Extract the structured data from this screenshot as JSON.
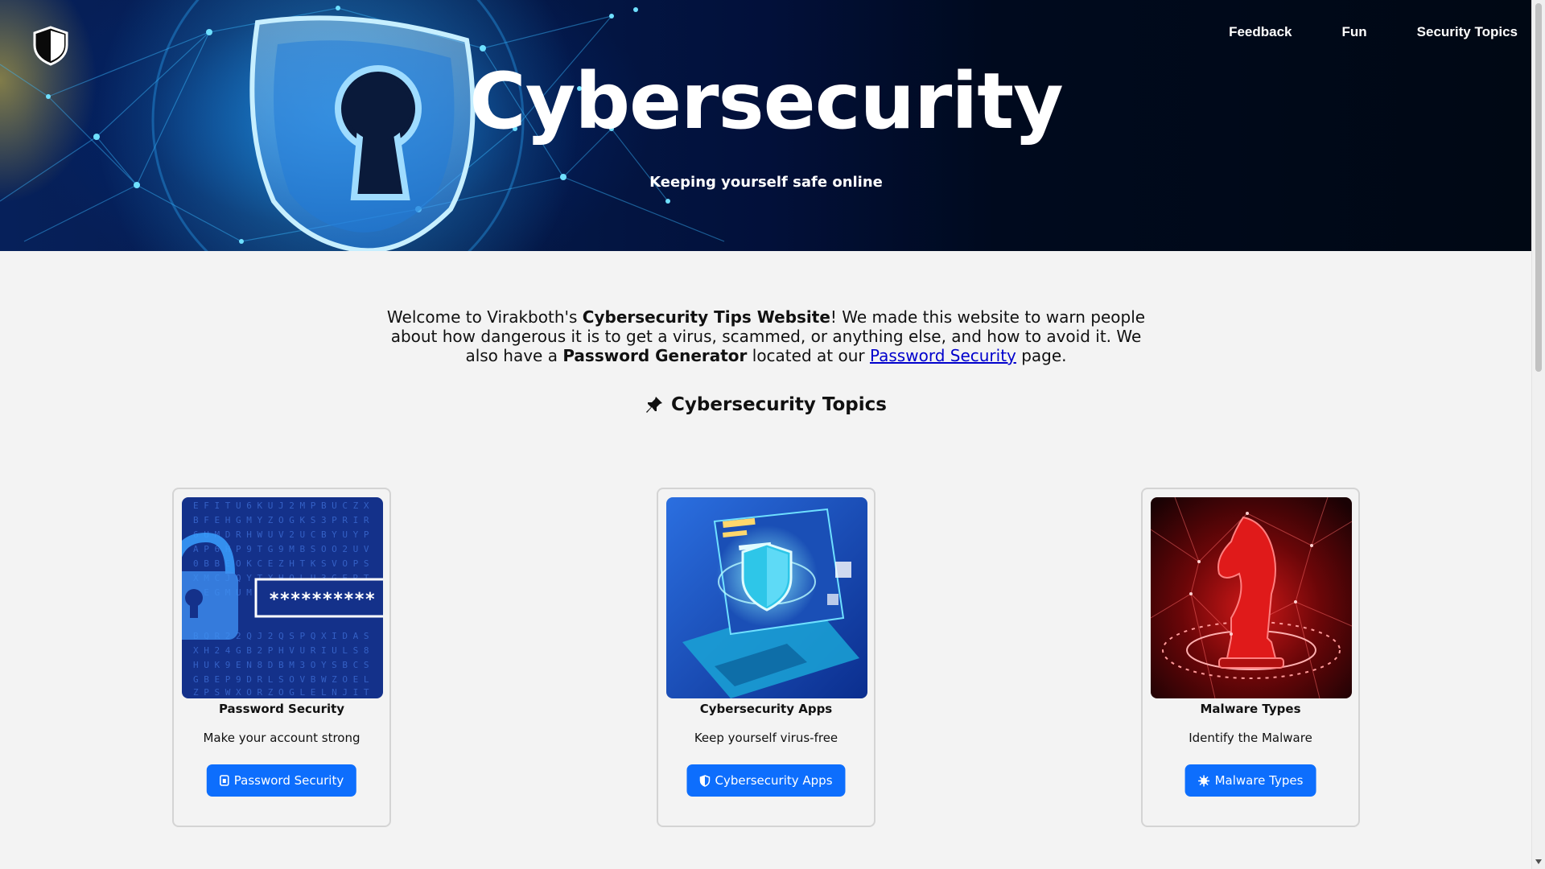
{
  "nav": {
    "links": [
      "Feedback",
      "Fun",
      "Security Topics"
    ]
  },
  "hero": {
    "title": "Cybersecurity",
    "subtitle": "Keeping yourself safe online"
  },
  "intro": {
    "p1": "Welcome to Virakboth's ",
    "b1": "Cybersecurity Tips Website",
    "p2": "! We made this website to warn people about how dangerous it is to get a virus, scammed, or anything else, and how to avoid it. We also have a ",
    "b2": "Password Generator",
    "p3": " located at our ",
    "link": "Password Security",
    "p4": " page."
  },
  "topics": {
    "heading": "Cybersecurity Topics",
    "cards": [
      {
        "title": "Password Security",
        "desc": "Make your account strong",
        "button": "Password Security"
      },
      {
        "title": "Cybersecurity Apps",
        "desc": "Keep yourself virus-free",
        "button": "Cybersecurity Apps"
      },
      {
        "title": "Malware Types",
        "desc": "Identify the Malware",
        "button": "Malware Types"
      }
    ]
  },
  "card1_image": {
    "password_mask": "**********"
  },
  "colors": {
    "accent": "#0d6efd",
    "link": "#0000cc"
  }
}
